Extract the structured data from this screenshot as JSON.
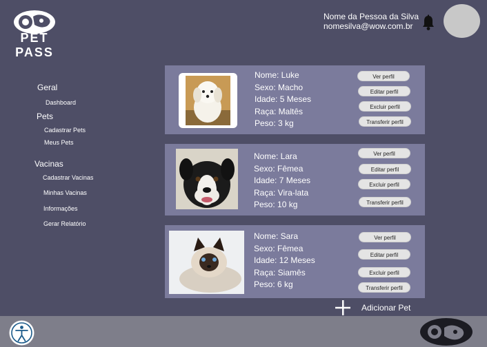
{
  "app": {
    "logo_text": "PET PASS"
  },
  "header": {
    "user_name": "Nome da Pessoa da Silva",
    "user_email": "nomesilva@wow.com.br"
  },
  "sidebar": {
    "sections": [
      {
        "label": "Geral",
        "items": [
          "Dashboard"
        ]
      },
      {
        "label": "Pets",
        "items": [
          "Cadastrar Pets",
          "Meus Pets"
        ]
      },
      {
        "label": "Vacinas",
        "items": [
          "Cadastrar Vacinas",
          "Minhas Vacinas",
          "Informações",
          "Gerar Relatório"
        ]
      }
    ]
  },
  "pets": [
    {
      "name": "Nome: Luke",
      "sex": "Sexo: Macho",
      "age": "Idade: 5 Meses",
      "breed": "Raça: Maltês",
      "weight": "Peso: 3 kg"
    },
    {
      "name": "Nome: Lara",
      "sex": "Sexo: Fêmea",
      "age": "Idade: 7 Meses",
      "breed": "Raça: Vira-lata",
      "weight": "Peso: 10 kg"
    },
    {
      "name": "Nome: Sara",
      "sex": "Sexo: Fêmea",
      "age": "Idade: 12 Meses",
      "breed": "Raça: Siamês",
      "weight": "Peso: 6 kg"
    }
  ],
  "actions": {
    "view": "Ver perfil",
    "edit": "Editar perfil",
    "delete": "Excluir perfil",
    "transfer": "Transferir perfil"
  },
  "add_pet": {
    "label": "Adicionar Pet"
  },
  "icons": {
    "bell": "bell-icon",
    "add": "plus-icon",
    "accessibility": "accessibility-icon"
  }
}
